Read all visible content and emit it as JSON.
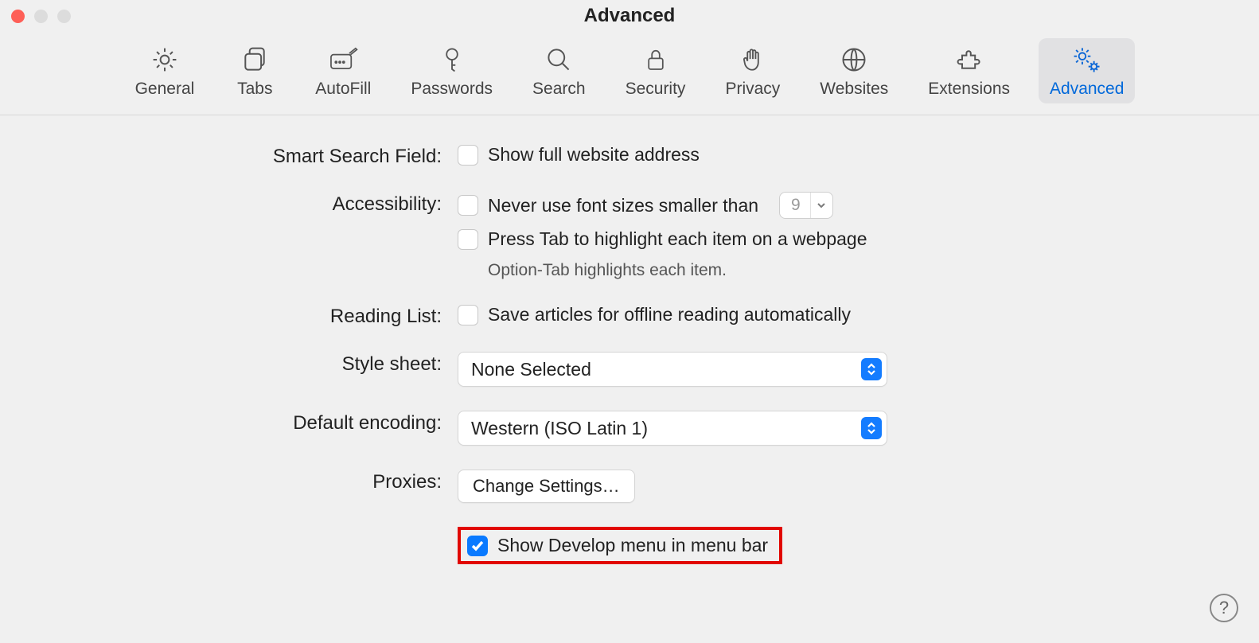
{
  "window": {
    "title": "Advanced"
  },
  "tabs": {
    "general": "General",
    "tabs": "Tabs",
    "autofill": "AutoFill",
    "passwords": "Passwords",
    "search": "Search",
    "security": "Security",
    "privacy": "Privacy",
    "websites": "Websites",
    "extensions": "Extensions",
    "advanced": "Advanced"
  },
  "rows": {
    "smart_search": {
      "label": "Smart Search Field:",
      "option": "Show full website address"
    },
    "accessibility": {
      "label": "Accessibility:",
      "font_option": "Never use font sizes smaller than",
      "font_value": "9",
      "tab_option": "Press Tab to highlight each item on a webpage",
      "tab_note": "Option-Tab highlights each item."
    },
    "reading_list": {
      "label": "Reading List:",
      "option": "Save articles for offline reading automatically"
    },
    "style_sheet": {
      "label": "Style sheet:",
      "value": "None Selected"
    },
    "default_encoding": {
      "label": "Default encoding:",
      "value": "Western (ISO Latin 1)"
    },
    "proxies": {
      "label": "Proxies:",
      "button": "Change Settings…"
    },
    "develop": {
      "option": "Show Develop menu in menu bar"
    }
  },
  "help": "?"
}
